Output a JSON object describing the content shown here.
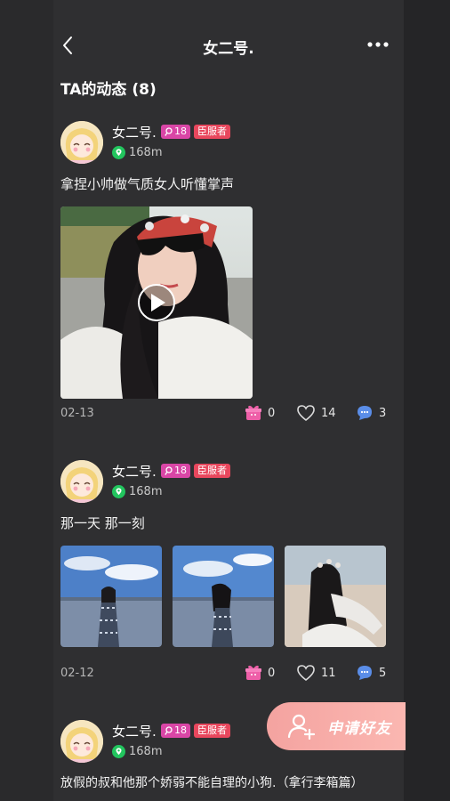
{
  "header": {
    "title": "女二号."
  },
  "section": {
    "title": "TA的动态 (8)"
  },
  "posts": [
    {
      "username": "女二号.",
      "age": "18",
      "role": "臣服者",
      "distance": "168m",
      "text": "拿捏小帅做气质女人听懂掌声",
      "date": "02-13",
      "gifts": "0",
      "likes": "14",
      "comments": "3"
    },
    {
      "username": "女二号.",
      "age": "18",
      "role": "臣服者",
      "distance": "168m",
      "text": "那一天 那一刻",
      "date": "02-12",
      "gifts": "0",
      "likes": "11",
      "comments": "5"
    },
    {
      "username": "女二号.",
      "age": "18",
      "role": "臣服者",
      "distance": "168m",
      "text": "放假的叔和他那个娇弱不能自理的小狗.（拿行李箱篇）"
    }
  ],
  "fab": {
    "label": "申请好友"
  },
  "colors": {
    "age_badge": "#d946a6",
    "role_badge": "#e8475d",
    "fab": "#f4a3a0",
    "location": "#22c55e"
  }
}
